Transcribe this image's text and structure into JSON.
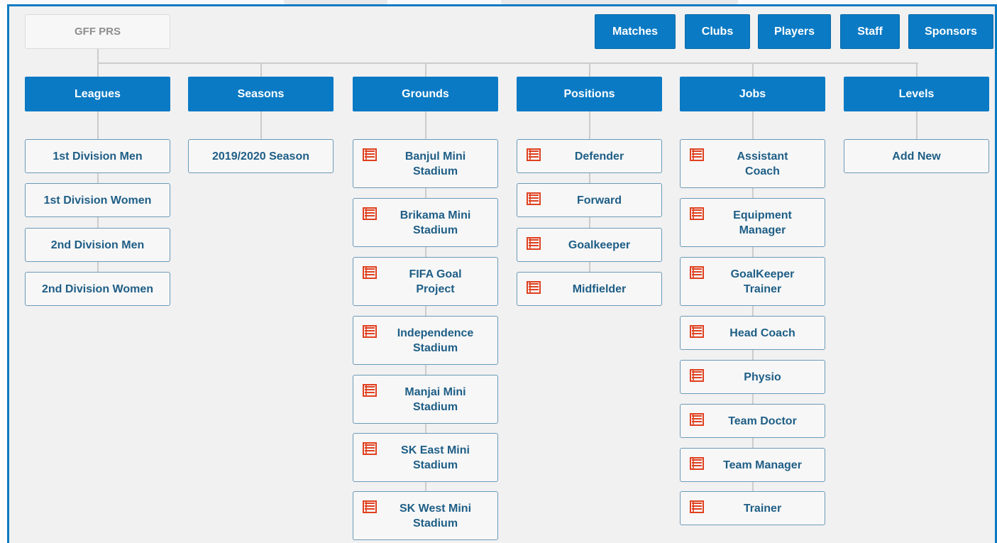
{
  "root": {
    "label": "GFF PRS"
  },
  "nav": [
    {
      "label": "Matches"
    },
    {
      "label": "Clubs"
    },
    {
      "label": "Players"
    },
    {
      "label": "Staff"
    },
    {
      "label": "Sponsors"
    }
  ],
  "columns": [
    {
      "label": "Leagues",
      "items": [
        "1st Division Men",
        "1st Division Women",
        "2nd Division Men",
        "2nd Division Women"
      ],
      "icon": null
    },
    {
      "label": "Seasons",
      "items": [
        "2019/2020 Season"
      ],
      "icon": null
    },
    {
      "label": "Grounds",
      "items": [
        "Banjul Mini Stadium",
        "Brikama Mini Stadium",
        "FIFA Goal Project",
        "Independence Stadium",
        "Manjai Mini Stadium",
        "SK East Mini Stadium",
        "SK West Mini Stadium"
      ],
      "icon": "list-icon"
    },
    {
      "label": "Positions",
      "items": [
        "Defender",
        "Forward",
        "Goalkeeper",
        "Midfielder"
      ],
      "icon": "list-icon"
    },
    {
      "label": "Jobs",
      "items": [
        "Assistant Coach",
        "Equipment Manager",
        "GoalKeeper Trainer",
        "Head Coach",
        "Physio",
        "Team Doctor",
        "Team Manager",
        "Trainer"
      ],
      "icon": "list-icon"
    },
    {
      "label": "Levels",
      "items": [
        "Add New"
      ],
      "icon": null
    }
  ],
  "colors": {
    "accent": "#0a7ac4",
    "icon": "#e0401f",
    "item_text": "#1e5e86",
    "background": "#f1f1f1"
  }
}
